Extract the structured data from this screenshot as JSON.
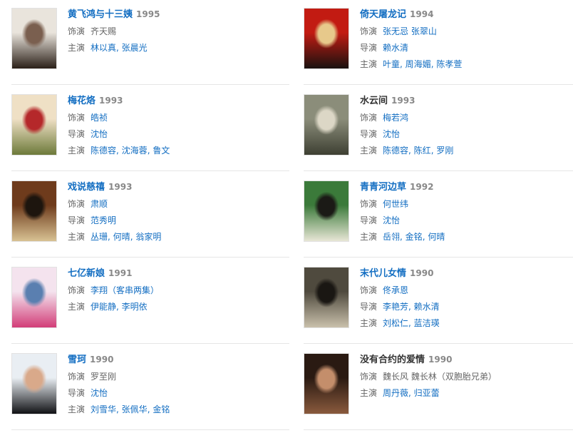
{
  "labels": {
    "role": "饰演",
    "director": "导演",
    "cast": "主演"
  },
  "items": [
    {
      "title": "黄飞鸿与十三姨",
      "year": "1995",
      "role": "齐天赐",
      "cast": [
        "林以真",
        "张晨光"
      ],
      "poster_colors": [
        "#e9e4dc",
        "#2b2018",
        "#7a5f4f"
      ]
    },
    {
      "title": "倚天屠龙记",
      "year": "1994",
      "role": "张无忌 张翠山",
      "director": "赖水清",
      "cast": [
        "叶童",
        "周海媚",
        "陈孝萱"
      ],
      "poster_colors": [
        "#c21b12",
        "#1a1210",
        "#e7c98b"
      ]
    },
    {
      "title": "梅花烙",
      "year": "1993",
      "role": "皓祯",
      "director": "沈怡",
      "cast": [
        "陈德容",
        "沈海蓉",
        "鲁文"
      ],
      "poster_colors": [
        "#efe0c5",
        "#6d7a3a",
        "#b5282a"
      ]
    },
    {
      "title": "水云间",
      "year": "1993",
      "plain_title": true,
      "role": "梅若鸿",
      "director": "沈怡",
      "cast": [
        "陈德容",
        "陈红",
        "罗刚"
      ],
      "poster_colors": [
        "#8b8d7a",
        "#3e4033",
        "#dcd7c6"
      ]
    },
    {
      "title": "戏说慈禧",
      "year": "1993",
      "role": "肃顺",
      "director": "范秀明",
      "cast": [
        "丛珊",
        "何晴",
        "翁家明"
      ],
      "poster_colors": [
        "#6e3b1c",
        "#d8c293",
        "#1d150e"
      ]
    },
    {
      "title": "青青河边草",
      "year": "1992",
      "role": "何世纬",
      "director": "沈怡",
      "cast": [
        "岳翎",
        "金铭",
        "何晴"
      ],
      "poster_colors": [
        "#3b7a3a",
        "#e8e6d6",
        "#1b1a16"
      ]
    },
    {
      "title": "七亿新娘",
      "year": "1991",
      "role": "李翔（客串两集）",
      "cast": [
        "伊能静",
        "李明依"
      ],
      "poster_colors": [
        "#f4e3ee",
        "#d23d78",
        "#5a7fb0"
      ]
    },
    {
      "title": "末代儿女情",
      "year": "1990",
      "role": "佟承恩",
      "director": "李艳芳, 赖水清",
      "cast": [
        "刘松仁",
        "蓝洁瑛"
      ],
      "poster_colors": [
        "#4f4a3e",
        "#c9c0ab",
        "#1a1713"
      ]
    },
    {
      "title": "雪珂",
      "year": "1990",
      "role": "罗至刚",
      "director": "沈怡",
      "cast": [
        "刘雪华",
        "张佩华",
        "金铭"
      ],
      "poster_colors": [
        "#e9eef3",
        "#111215",
        "#d9a98a"
      ]
    },
    {
      "title": "没有合约的爱情",
      "year": "1990",
      "plain_title": true,
      "role": "魏长风 魏长林（双胞胎兄弟）",
      "cast": [
        "周丹薇",
        "归亚蕾"
      ],
      "poster_colors": [
        "#2a1a12",
        "#8a5a3d",
        "#c48e6b"
      ]
    }
  ]
}
